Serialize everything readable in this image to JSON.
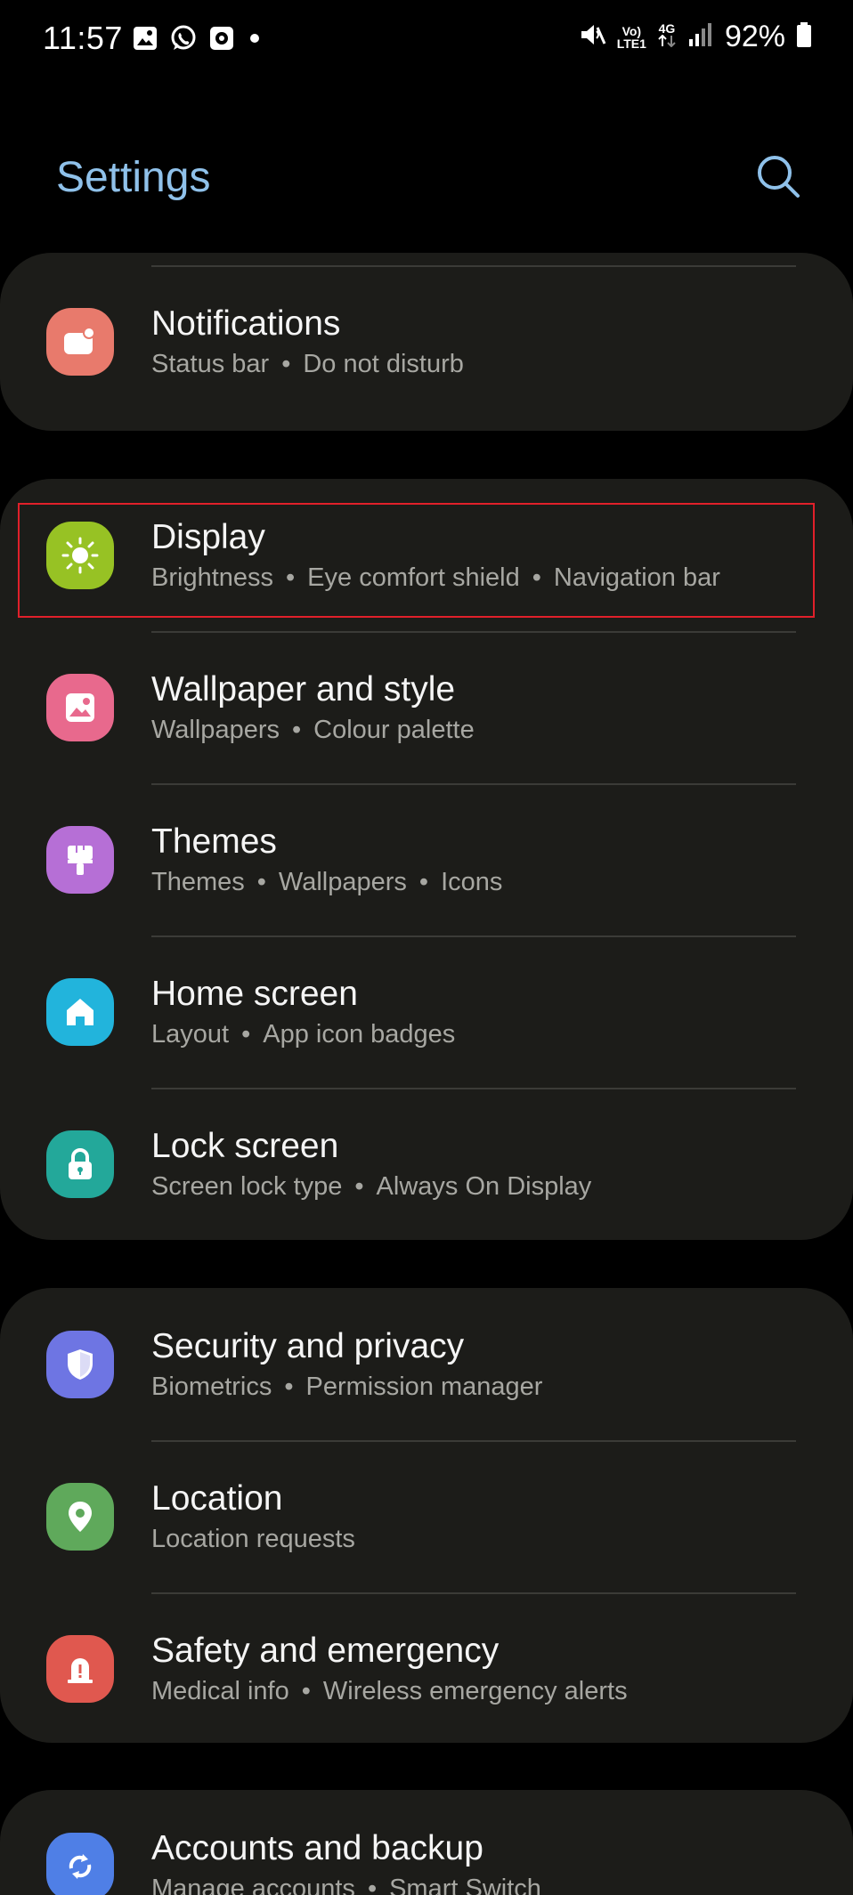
{
  "status_bar": {
    "time": "11:57",
    "network_volte": "Vo)",
    "network_lte": "LTE1",
    "network_4g": "4G",
    "battery_text": "92%",
    "icons": [
      "gallery-icon",
      "whatsapp-icon",
      "screen-recorder-icon",
      "notification-dot-icon",
      "mute-icon",
      "signal-icon",
      "battery-icon"
    ]
  },
  "header": {
    "title": "Settings",
    "search_icon": "search-icon"
  },
  "colors": {
    "background": "#000000",
    "card": "#1c1c19",
    "title_accent": "#8fc1ea",
    "highlight": "#e0202a"
  },
  "sections": [
    {
      "items": [
        {
          "title": "Notifications",
          "subtitle": [
            "Status bar",
            "Do not disturb"
          ],
          "icon": "notifications-icon",
          "icon_color": "#e87a6c"
        }
      ]
    },
    {
      "items": [
        {
          "title": "Display",
          "subtitle": [
            "Brightness",
            "Eye comfort shield",
            "Navigation bar"
          ],
          "icon": "display-sun-icon",
          "icon_color": "#97c224",
          "highlighted": true
        },
        {
          "title": "Wallpaper and style",
          "subtitle": [
            "Wallpapers",
            "Colour palette"
          ],
          "icon": "wallpaper-icon",
          "icon_color": "#e8698d"
        },
        {
          "title": "Themes",
          "subtitle": [
            "Themes",
            "Wallpapers",
            "Icons"
          ],
          "icon": "themes-brush-icon",
          "icon_color": "#b66fd6"
        },
        {
          "title": "Home screen",
          "subtitle": [
            "Layout",
            "App icon badges"
          ],
          "icon": "home-icon",
          "icon_color": "#22b4dc"
        },
        {
          "title": "Lock screen",
          "subtitle": [
            "Screen lock type",
            "Always On Display"
          ],
          "icon": "lock-icon",
          "icon_color": "#23a89a"
        }
      ]
    },
    {
      "items": [
        {
          "title": "Security and privacy",
          "subtitle": [
            "Biometrics",
            "Permission manager"
          ],
          "icon": "shield-icon",
          "icon_color": "#6e75e3"
        },
        {
          "title": "Location",
          "subtitle": [
            "Location requests"
          ],
          "icon": "location-pin-icon",
          "icon_color": "#5fa95b"
        },
        {
          "title": "Safety and emergency",
          "subtitle": [
            "Medical info",
            "Wireless emergency alerts"
          ],
          "icon": "emergency-icon",
          "icon_color": "#e0584f"
        }
      ]
    },
    {
      "items": [
        {
          "title": "Accounts and backup",
          "subtitle": [
            "Manage accounts",
            "Smart Switch"
          ],
          "icon": "sync-icon",
          "icon_color": "#4f7fe6"
        }
      ]
    }
  ]
}
